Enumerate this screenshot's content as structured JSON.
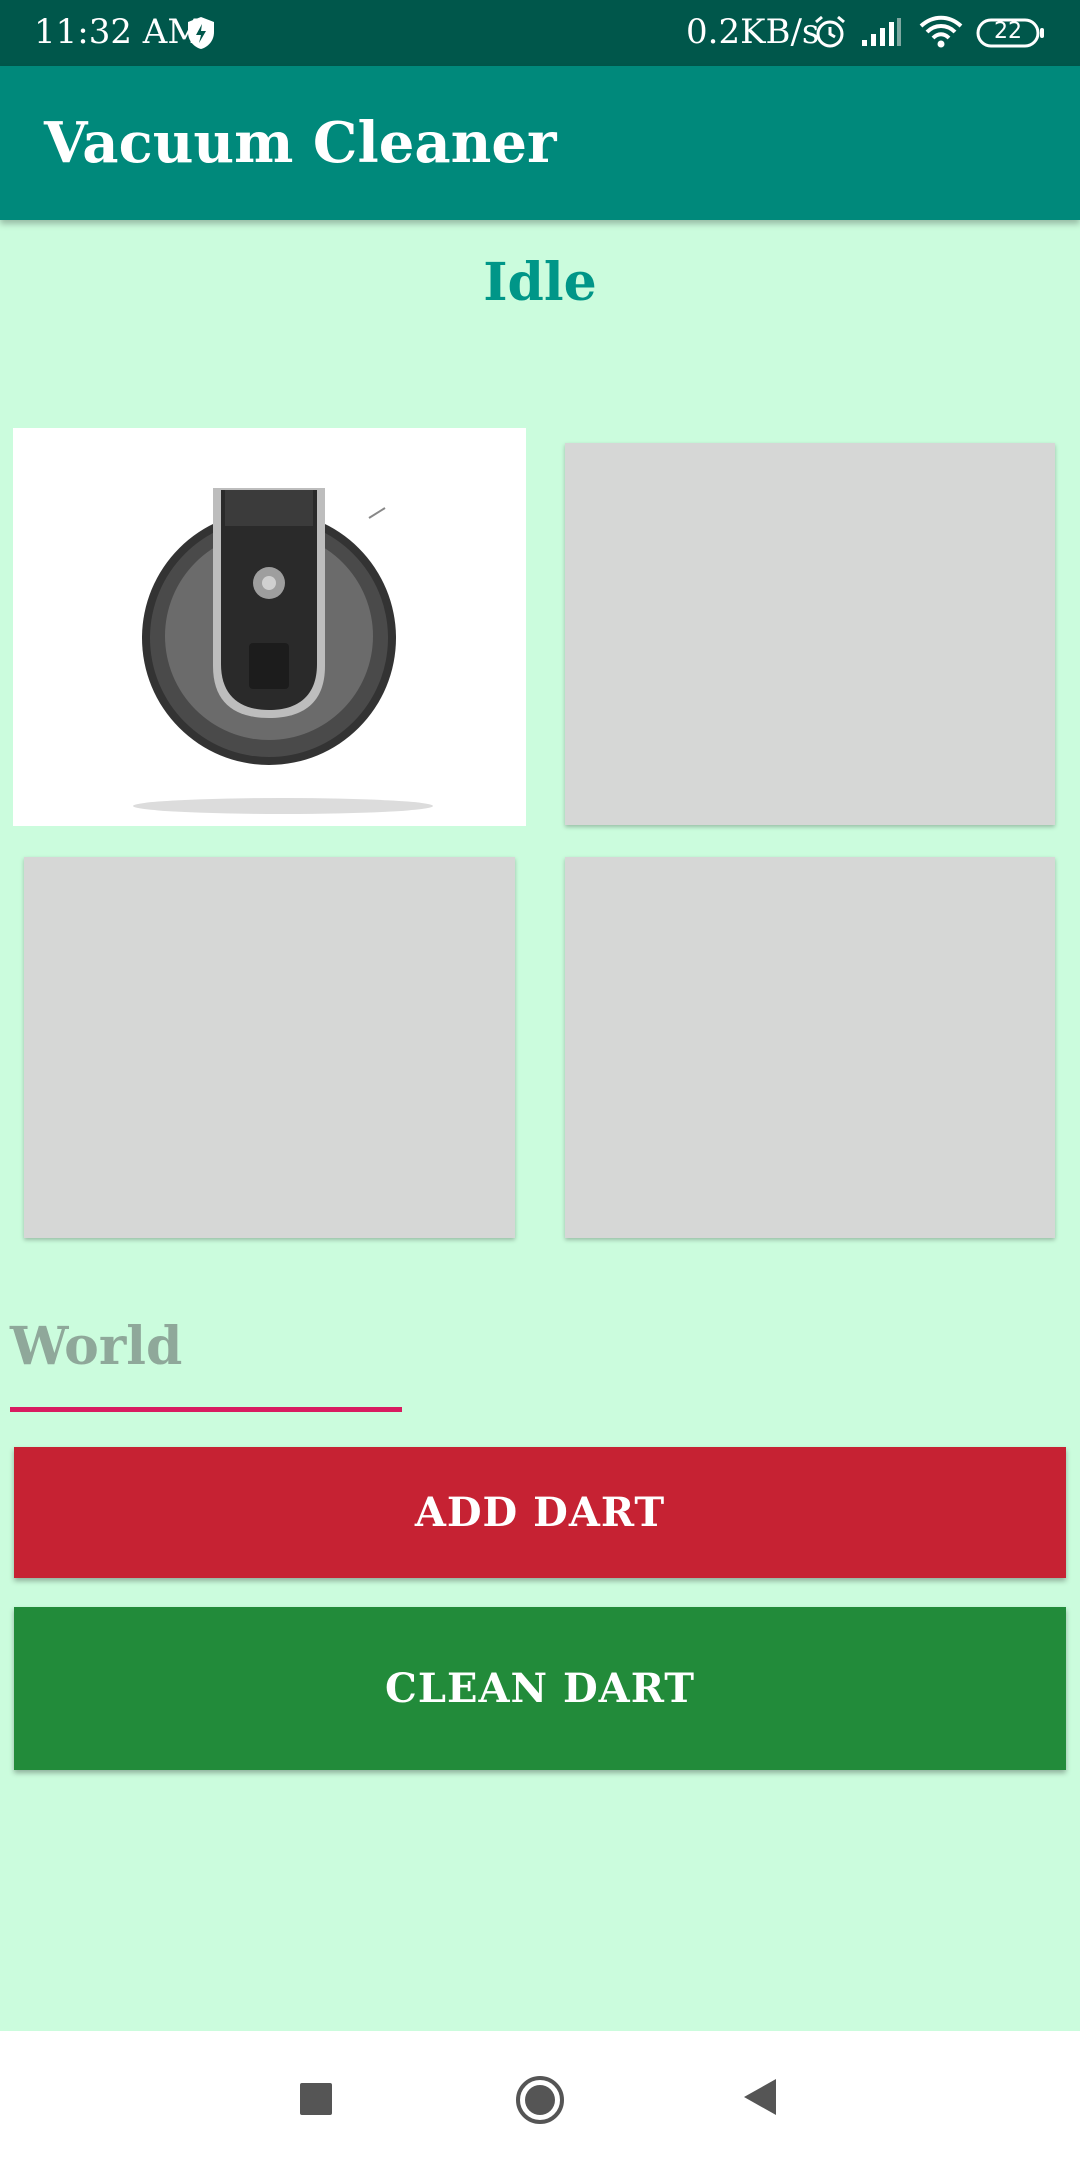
{
  "status_bar": {
    "time": "11:32 AM",
    "net_speed": "0.2KB/s",
    "battery": "22",
    "icons": [
      "shield-icon",
      "alarm-icon",
      "signal-icon",
      "wifi-icon",
      "battery-icon"
    ]
  },
  "app_bar": {
    "title": "Vacuum Cleaner"
  },
  "main": {
    "state": "Idle",
    "grid": [
      {
        "type": "image",
        "icon": "robot-vacuum-image"
      },
      {
        "type": "empty"
      },
      {
        "type": "empty"
      },
      {
        "type": "empty"
      }
    ],
    "input": {
      "value": "World",
      "underline_color": "#D81B60"
    },
    "buttons": {
      "add_label": "ADD DART",
      "clean_label": "CLEAN DART"
    }
  },
  "nav_bar": {
    "icons": [
      "recents-icon",
      "home-icon",
      "back-icon"
    ]
  },
  "colors": {
    "background": "#CBFCDD",
    "app_bar": "#00897B",
    "status_bar": "#00574B",
    "accent_text": "#009688",
    "add_button": "#C62233",
    "clean_button": "#228B3A",
    "empty_cell": "#D6D7D6"
  }
}
